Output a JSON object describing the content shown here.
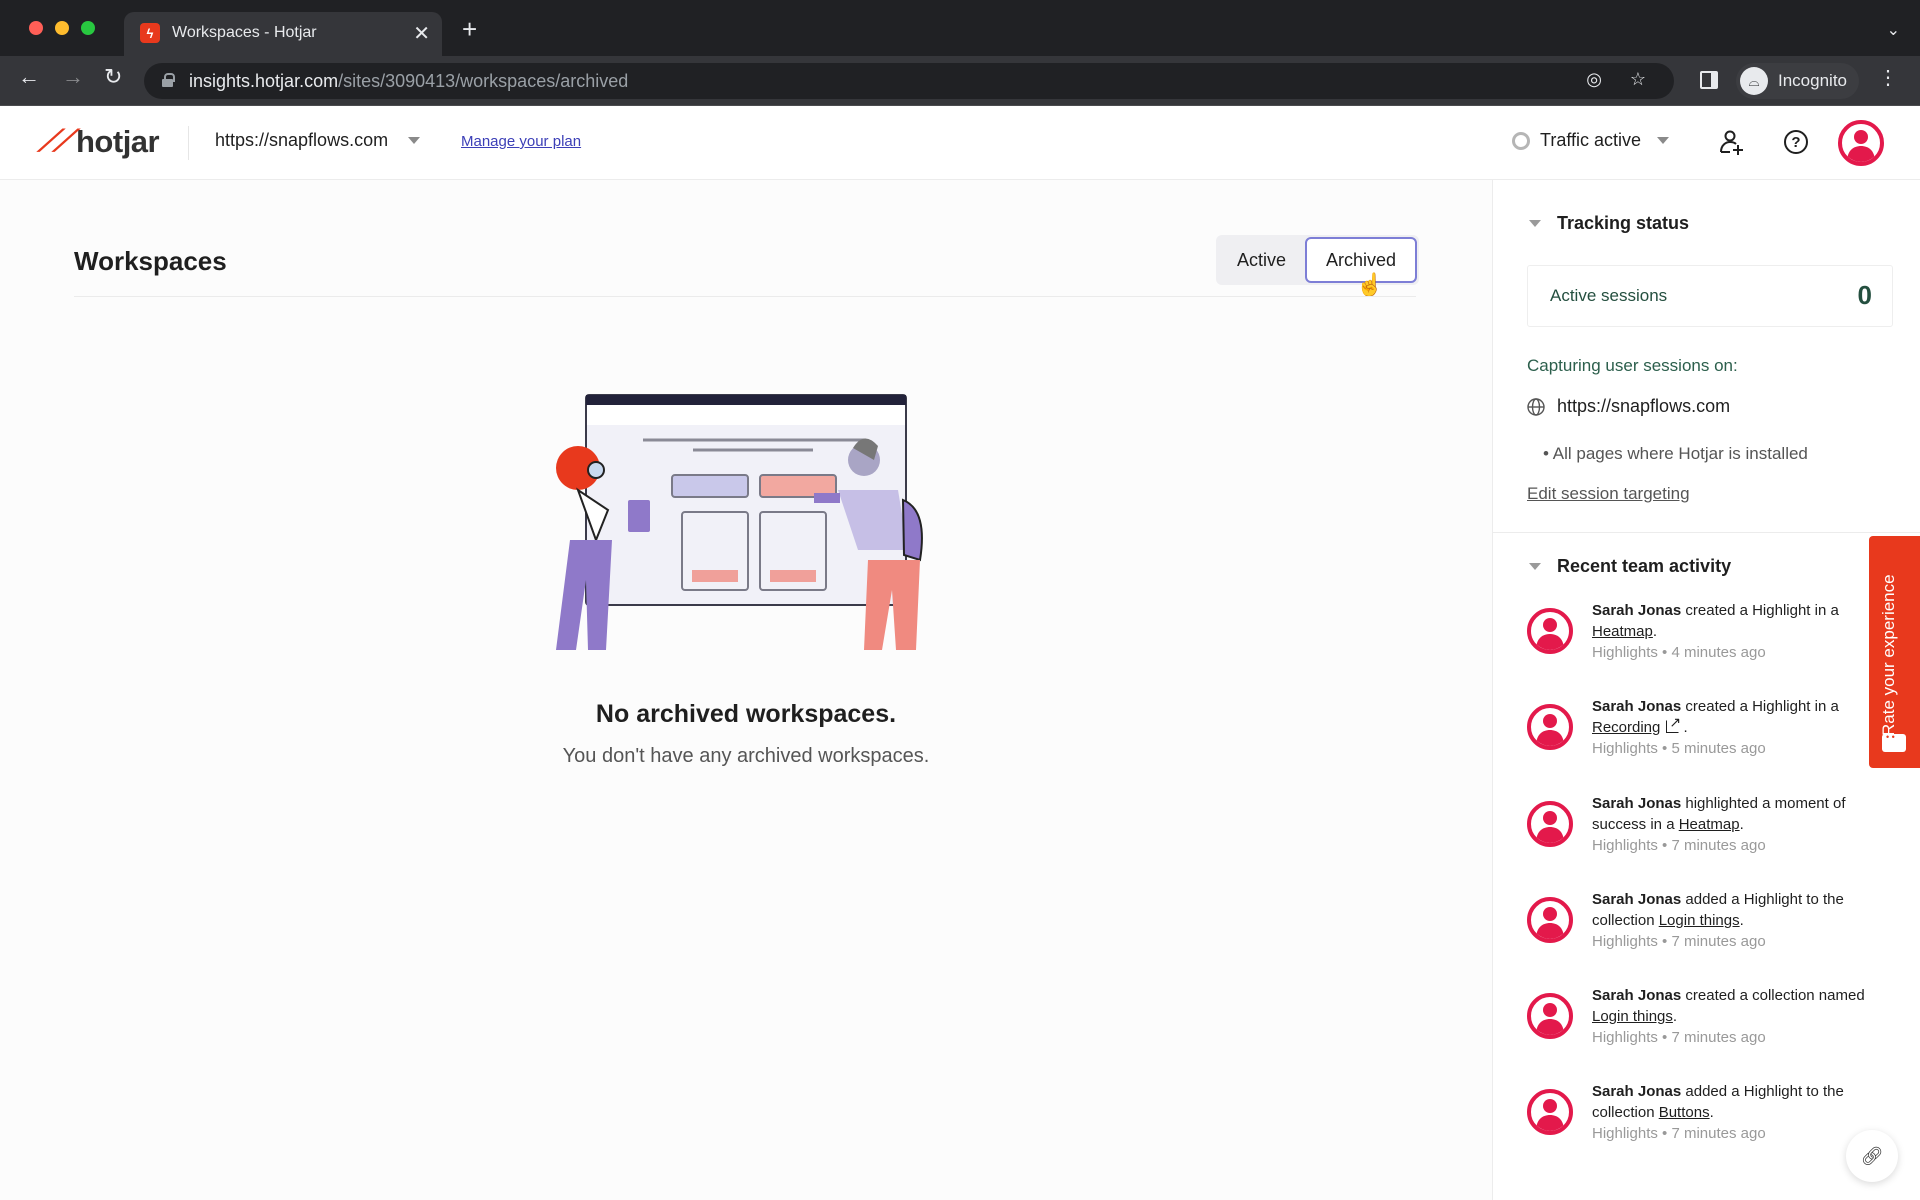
{
  "browser": {
    "tab_title": "Workspaces - Hotjar",
    "new_tab_label": "+",
    "url_host": "insights.hotjar.com",
    "url_path": "/sites/3090413/workspaces/archived",
    "profile_label": "Incognito"
  },
  "header": {
    "logo_text": "hotjar",
    "site": "https://snapflows.com",
    "manage_plan": "Manage your plan",
    "traffic_status": "Traffic active",
    "help_glyph": "?"
  },
  "main": {
    "title": "Workspaces",
    "tabs": [
      {
        "label": "Active",
        "selected": false
      },
      {
        "label": "Archived",
        "selected": true
      }
    ],
    "empty_title": "No archived workspaces.",
    "empty_subtitle": "You don't have any archived workspaces."
  },
  "panel": {
    "tracking": {
      "title": "Tracking status",
      "sessions_label": "Active sessions",
      "sessions_value": "0",
      "capturing_label": "Capturing user sessions on:",
      "site": "https://snapflows.com",
      "pages": "All pages where Hotjar is installed",
      "edit_link": "Edit session targeting"
    },
    "activity": {
      "title": "Recent team activity",
      "items": [
        {
          "user": "Sarah Jonas",
          "action": " created a Highlight in a ",
          "link": "Heatmap",
          "external": false,
          "suffix": ".",
          "meta": "Highlights • 4 minutes ago"
        },
        {
          "user": "Sarah Jonas",
          "action": " created a Highlight in a ",
          "link": "Recording",
          "external": true,
          "suffix": " .",
          "meta": "Highlights • 5 minutes ago"
        },
        {
          "user": "Sarah Jonas",
          "action": " highlighted a moment of success in a ",
          "link": "Heatmap",
          "external": false,
          "suffix": ".",
          "meta": "Highlights • 7 minutes ago"
        },
        {
          "user": "Sarah Jonas",
          "action": " added a Highlight to the collection ",
          "link": "Login things",
          "external": false,
          "suffix": ".",
          "meta": "Highlights • 7 minutes ago"
        },
        {
          "user": "Sarah Jonas",
          "action": " created a collection named ",
          "link": "Login things",
          "external": false,
          "suffix": ".",
          "meta": "Highlights • 7 minutes ago"
        },
        {
          "user": "Sarah Jonas",
          "action": " added a Highlight to the collection ",
          "link": "Buttons",
          "external": false,
          "suffix": ".",
          "meta": "Highlights • 7 minutes ago"
        }
      ]
    }
  },
  "feedback": {
    "rate_label": "Rate your experience"
  },
  "colors": {
    "brand": "#e8391d",
    "avatar": "#e3194b",
    "selected_tab_border": "#7d7ed6",
    "tracking_text": "#244f3f",
    "link": "#3c3fb7"
  }
}
